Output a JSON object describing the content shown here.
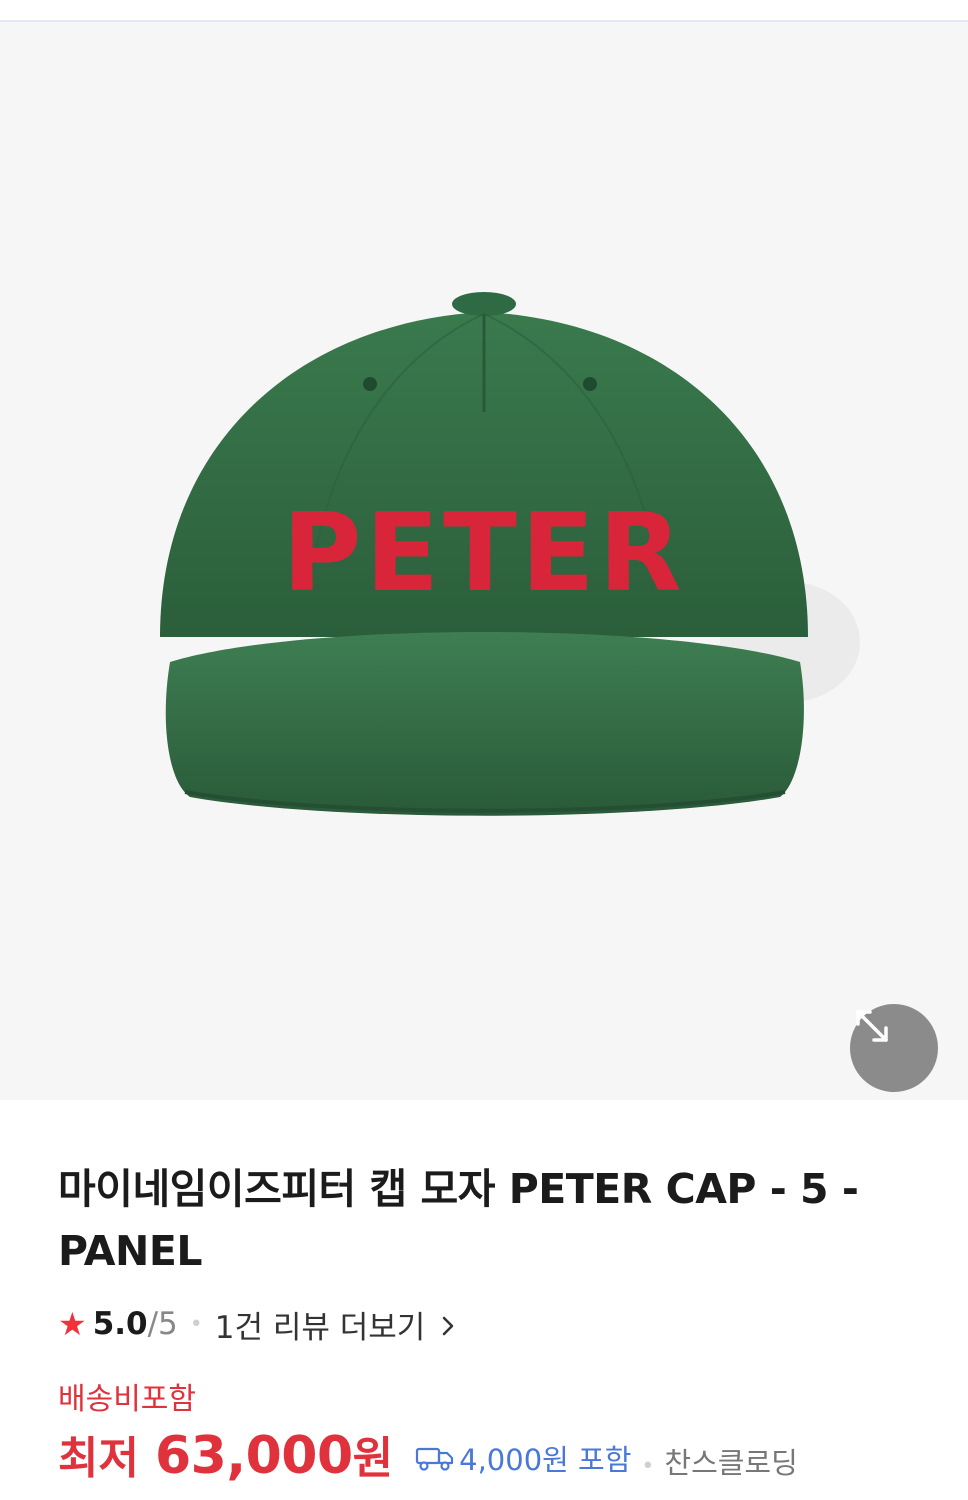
{
  "product": {
    "title": "마이네임이즈피터 캡 모자 PETER CAP - 5 -PANEL",
    "image_text": "PETER",
    "rating": {
      "star_icon": "star-icon",
      "score": "5.0",
      "max": "/5",
      "reviews_link": "1건 리뷰 더보기"
    },
    "shipping_note": "배송비포함",
    "price": {
      "label": "최저",
      "value": "63,000",
      "unit": "원"
    },
    "shipping_fee": "4,000원 포함",
    "seller": "찬스클로딩"
  },
  "colors": {
    "accent_red": "#e0323c",
    "link_blue": "#4a78d9",
    "cap_green": "#2f6b42",
    "embroidery_red": "#d8253a"
  },
  "icons": {
    "expand": "expand-icon",
    "star": "star-icon",
    "chevron": "chevron-right-icon",
    "truck": "truck-icon"
  }
}
